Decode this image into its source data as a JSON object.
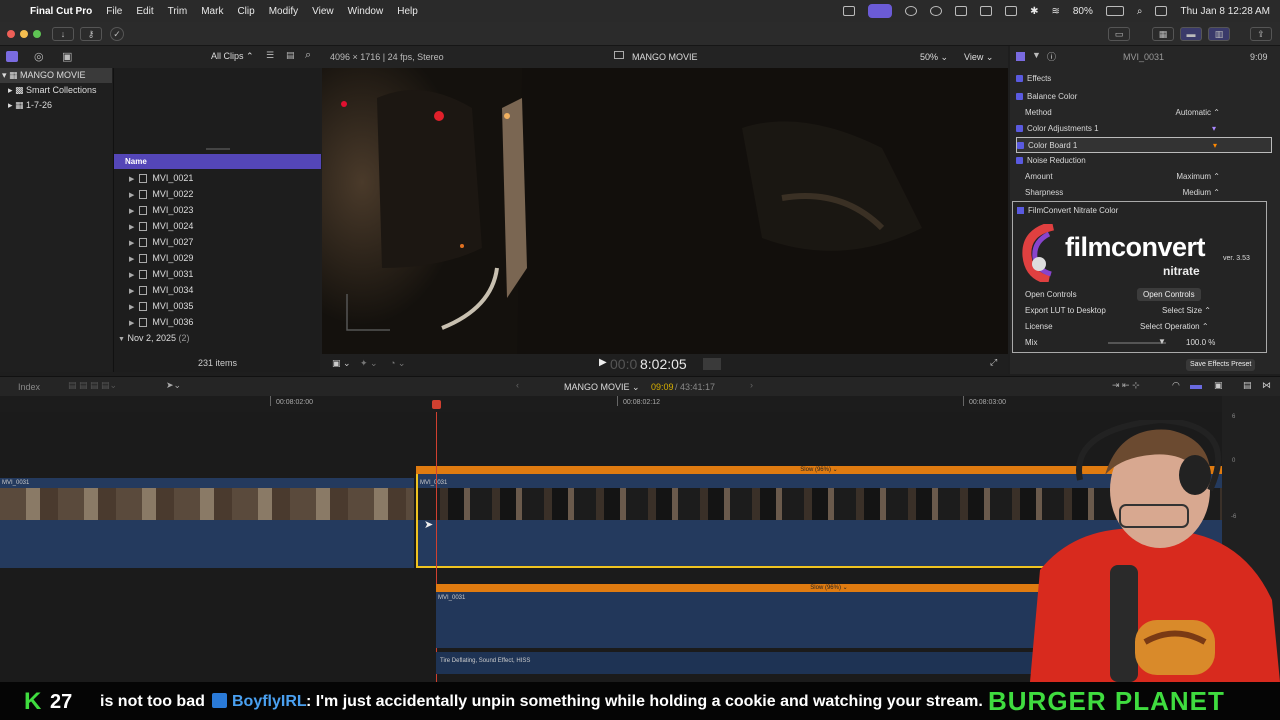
{
  "menubar": {
    "app_name": "Final Cut Pro",
    "menus": [
      "File",
      "Edit",
      "Trim",
      "Mark",
      "Clip",
      "Modify",
      "View",
      "Window",
      "Help"
    ],
    "battery": "80%",
    "datetime": "Thu Jan 8  12:28 AM"
  },
  "browser": {
    "filter_label": "All Clips",
    "library_name": "MANGO MOVIE",
    "library_rows": [
      "Smart Collections",
      "1-7-26"
    ],
    "column_header": "Name",
    "clips": [
      "MVI_0021",
      "MVI_0022",
      "MVI_0023",
      "MVI_0024",
      "MVI_0027",
      "MVI_0029",
      "MVI_0031",
      "MVI_0034",
      "MVI_0035",
      "MVI_0036"
    ],
    "group_label": "Nov 2, 2025",
    "group_count": "(2)",
    "item_count": "231 items"
  },
  "viewer": {
    "format": "4096 × 1716 | 24 fps, Stereo",
    "title": "MANGO MOVIE",
    "zoom": "50%",
    "view_label": "View",
    "timecode_dim": "00:0",
    "timecode": "8:02:05"
  },
  "inspector": {
    "clip_name": "MVI_0031",
    "duration": "9:09",
    "section": "Effects",
    "balance_color": "Balance Color",
    "method_label": "Method",
    "method_value": "Automatic",
    "color_adjustments": "Color Adjustments 1",
    "color_board": "Color Board 1",
    "noise_reduction": "Noise Reduction",
    "amount_label": "Amount",
    "amount_value": "Maximum",
    "sharpness_label": "Sharpness",
    "sharpness_value": "Medium",
    "filmconvert_title": "FilmConvert Nitrate Color",
    "logo_main": "filmconvert",
    "logo_sub": "nitrate",
    "logo_version": "ver. 3.53",
    "open_controls_label": "Open Controls",
    "open_controls_button": "Open Controls",
    "export_lut_label": "Export LUT to Desktop",
    "export_lut_value": "Select Size",
    "license_label": "License",
    "license_value": "Select Operation",
    "mix_label": "Mix",
    "mix_value": "100.0",
    "mix_unit": "%",
    "save_preset": "Save Effects Preset"
  },
  "timeline": {
    "index_label": "Index",
    "project_name": "MANGO MOVIE",
    "position": "09:09",
    "total": "43:41:17",
    "ruler_ticks": [
      "00:08:02:00",
      "00:08:02:12",
      "00:08:03:00"
    ],
    "clip_left": "MVI_0031",
    "clip_selected": "MVI_0031",
    "speed_label": "Slow (96%)",
    "clip_lower": "MVI_0031",
    "speed_label_lower": "Slow (96%)",
    "audio_clip": "Tire Deflating, Sound Effect, HISS",
    "meter_labels": [
      "6",
      "0",
      "-6"
    ]
  },
  "ticker": {
    "k_count": "27",
    "text_before": "is not too bad",
    "username": "BoyflyIRL",
    "message": ": I'm just accidentally unpin something while holding a cookie and watching your stream.",
    "brand": "BURGER PLANET"
  },
  "colors": {
    "accent": "#5446b8",
    "selection": "#f0c420",
    "speed_bar": "#e07b10",
    "clip_blue": "#243a5e",
    "ticker_green": "#3fdc3f"
  }
}
